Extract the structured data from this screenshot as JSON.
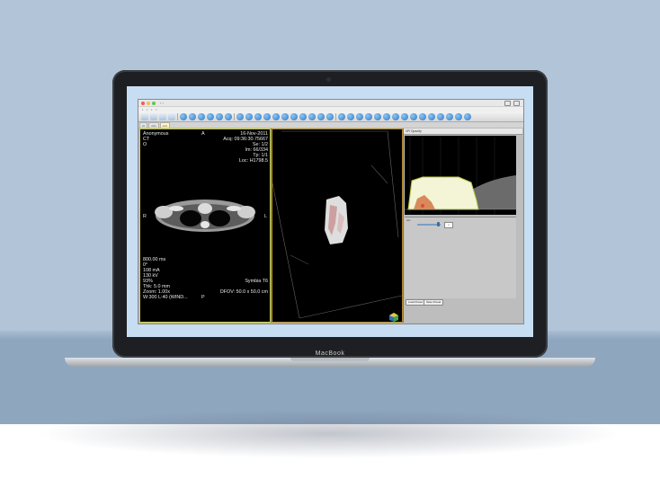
{
  "laptop": {
    "brand": "MacBook"
  },
  "toolbar": {
    "icons": [
      "back-icon",
      "forward-icon",
      "layout-icon",
      "window-icon",
      "zoom-icon",
      "pan-icon",
      "rotate-icon",
      "measure-icon",
      "roi-icon",
      "3d-icon",
      "mpr-icon",
      "camera-icon",
      "export-icon",
      "settings-icon",
      "help-icon"
    ]
  },
  "ct_view": {
    "top_left": [
      "Anonymous",
      "CT",
      "O"
    ],
    "orientation_top": "A",
    "top_right": [
      "16-Nov-2011",
      "Acq: 09:36:30.75667",
      "Se: 1/2",
      "Im: 66/334",
      "Tp: 1/1",
      "Loc: H1798.5"
    ],
    "orientation_left": "R",
    "orientation_right": "L",
    "bottom_left": [
      "800.00 ms",
      "0°",
      "108 mA",
      "130 kV",
      "93%",
      "Thk: 5.0 mm",
      "Zoom: 1.00x",
      "W:300 L:40 (WIND..."
    ],
    "bottom_right_1": "Symbia T6",
    "bottom_right_2": "DFOV: 50.0 x 50.0 cm",
    "orientation_bottom": "P"
  },
  "vr_panel": {
    "title": "VR Opacity"
  },
  "buttons": {
    "load_preset": "Load Preset",
    "save_preset": "Save Preset"
  },
  "colors": {
    "ct_frame": "#d0d040",
    "vr_frame": "#b58e2a",
    "histogram_fill": "#f3f5d6"
  }
}
